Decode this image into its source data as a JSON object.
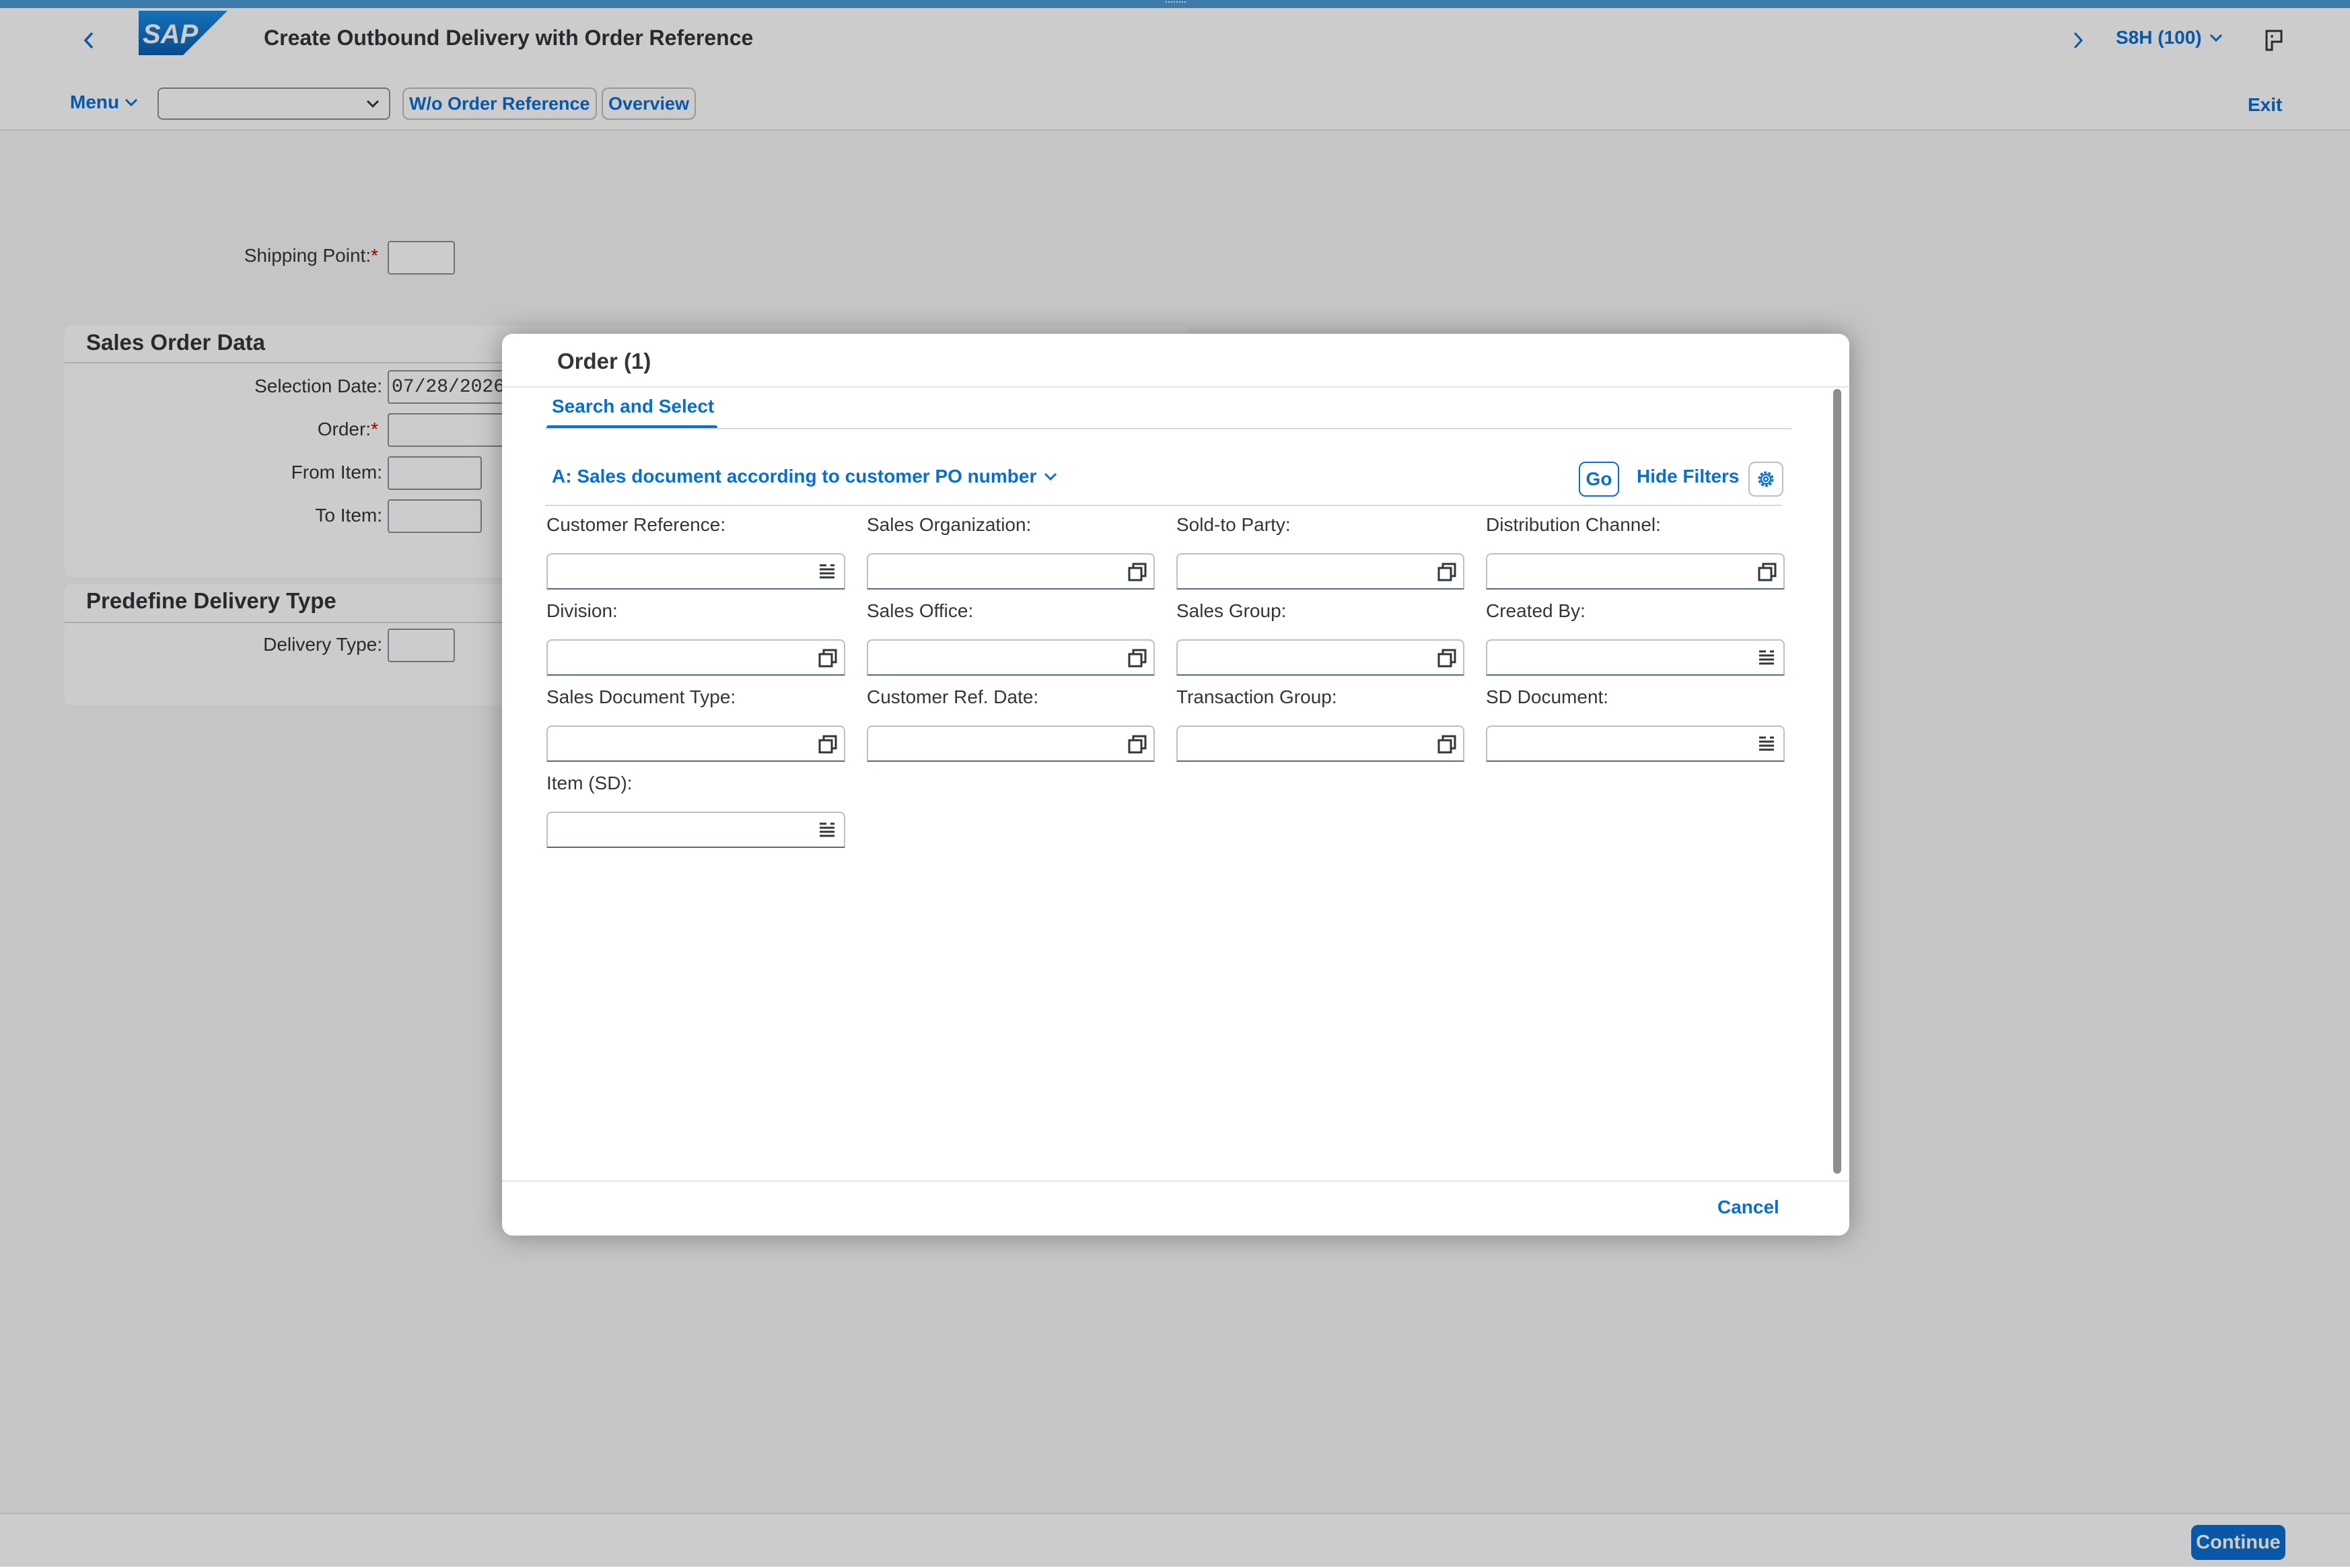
{
  "shell": {
    "app_title": "Create Outbound Delivery with Order Reference",
    "system": "S8H (100)",
    "logo_text": "SAP"
  },
  "toolbar": {
    "menu_label": "Menu",
    "select_value": "",
    "wo_order_ref_label": "W/o Order Reference",
    "overview_label": "Overview",
    "exit_label": "Exit"
  },
  "form": {
    "shipping_point_label": "Shipping Point:",
    "required_mark": "*",
    "shipping_point_value": "",
    "sales_order_group": {
      "title": "Sales Order Data",
      "selection_date_label": "Selection Date:",
      "selection_date_value": "07/28/2026",
      "order_label": "Order:",
      "from_item_label": "From Item:",
      "to_item_label": "To Item:"
    },
    "delivery_type_group": {
      "title": "Predefine Delivery Type",
      "delivery_type_label": "Delivery Type:"
    }
  },
  "dialog": {
    "title": "Order (1)",
    "tab_label": "Search and Select",
    "variant_label": "A: Sales document according to customer PO number",
    "go_label": "Go",
    "hide_filters_label": "Hide Filters",
    "cancel_label": "Cancel",
    "filters": [
      {
        "label": "Customer Reference:",
        "icon": "list-icon",
        "value": ""
      },
      {
        "label": "Sales Organization:",
        "icon": "value-help-icon",
        "value": ""
      },
      {
        "label": "Sold-to Party:",
        "icon": "value-help-icon",
        "value": ""
      },
      {
        "label": "Distribution Channel:",
        "icon": "value-help-icon",
        "value": ""
      },
      {
        "label": "Division:",
        "icon": "value-help-icon",
        "value": ""
      },
      {
        "label": "Sales Office:",
        "icon": "value-help-icon",
        "value": ""
      },
      {
        "label": "Sales Group:",
        "icon": "value-help-icon",
        "value": ""
      },
      {
        "label": "Created By:",
        "icon": "list-icon",
        "value": ""
      },
      {
        "label": "Sales Document Type:",
        "icon": "value-help-icon",
        "value": ""
      },
      {
        "label": "Customer Ref. Date:",
        "icon": "value-help-icon",
        "value": ""
      },
      {
        "label": "Transaction Group:",
        "icon": "value-help-icon",
        "value": ""
      },
      {
        "label": "SD Document:",
        "icon": "list-icon",
        "value": ""
      },
      {
        "label": "Item (SD):",
        "icon": "list-icon",
        "value": ""
      }
    ]
  },
  "footer": {
    "continue_label": "Continue"
  },
  "colors": {
    "accent": "#0a6ed1",
    "shell_bar": "#4d9ad5",
    "required": "#bb0000"
  }
}
